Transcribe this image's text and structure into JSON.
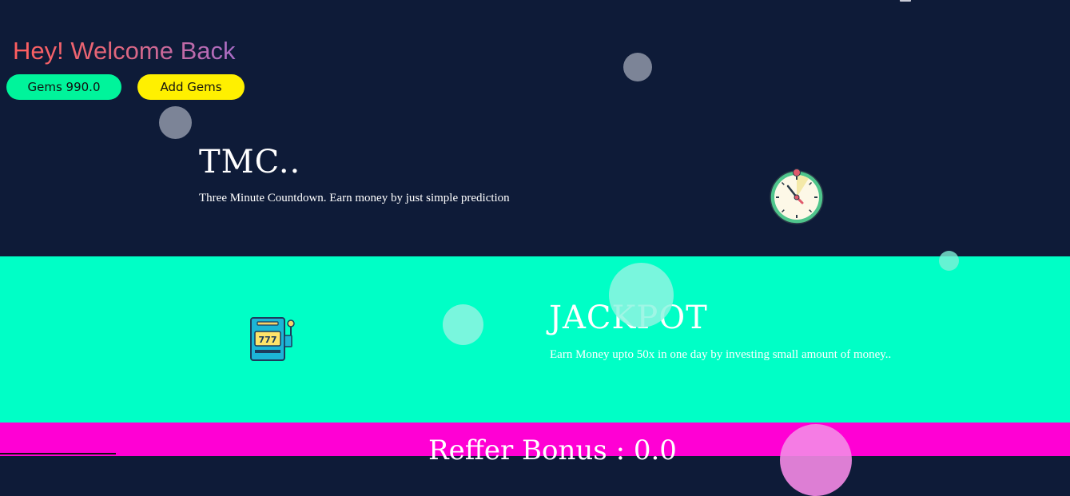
{
  "welcome": {
    "text": "Hey! Welcome Back"
  },
  "gems": {
    "label": "Gems 990.0",
    "add_label": "Add Gems"
  },
  "tmc": {
    "title": "TMC..",
    "description": "Three Minute Countdown. Earn money by just simple prediction",
    "icon": "stopwatch-icon"
  },
  "jackpot": {
    "title": "JACKPOT",
    "description": "Earn Money upto 50x in one day by investing small amount of money..",
    "icon": "slot-machine-icon"
  },
  "referral": {
    "text": "Reffer Bonus : 0.0"
  },
  "colors": {
    "hero_bg": "#0e1b38",
    "jackpot_bg": "#00ffc6",
    "referral_bg": "#ff00d4",
    "gems_pill": "#00f49b",
    "add_gems_pill": "#fff000"
  }
}
